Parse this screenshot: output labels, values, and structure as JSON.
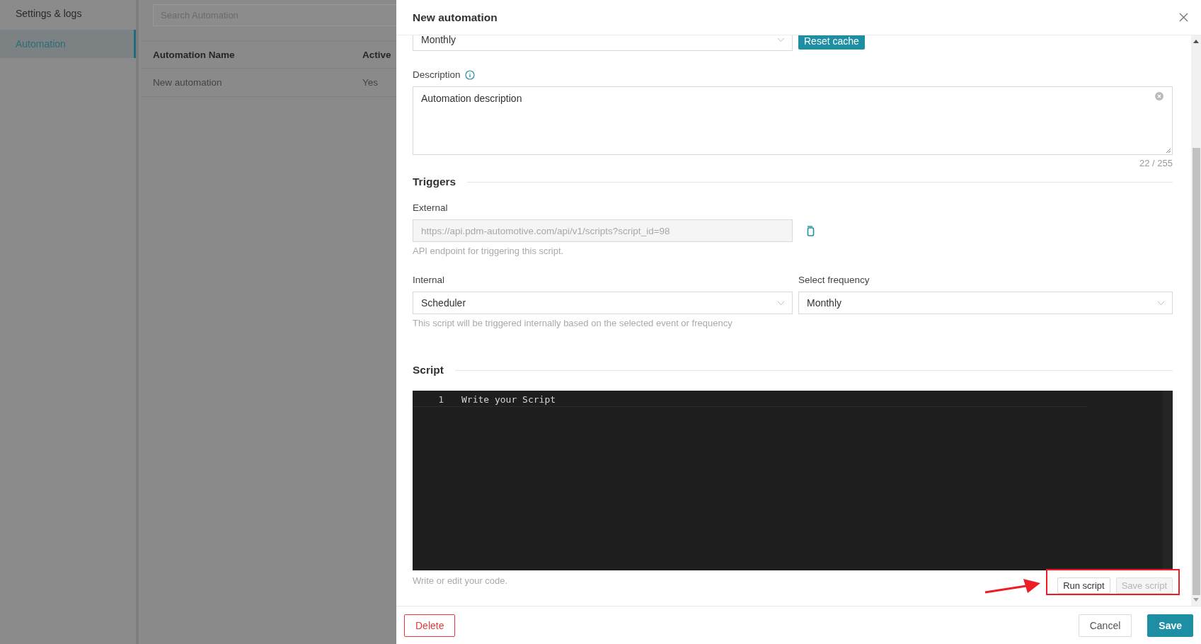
{
  "sidebar": {
    "items": [
      {
        "label": "Settings & logs",
        "selected": false
      },
      {
        "label": "Automation",
        "selected": true
      }
    ]
  },
  "search": {
    "placeholder": "Search Automation"
  },
  "table": {
    "columns": [
      "Automation Name",
      "Active"
    ],
    "rows": [
      [
        "New automation",
        "Yes"
      ]
    ]
  },
  "drawer": {
    "title": "New automation",
    "top_select": {
      "value": "Monthly"
    },
    "reset_button": "Reset cache",
    "description": {
      "label": "Description",
      "value": "Automation description",
      "counter": "22 / 255"
    },
    "triggers": {
      "heading": "Triggers",
      "external": {
        "label": "External",
        "value": "https://api.pdm-automotive.com/api/v1/scripts?script_id=98",
        "help": "API endpoint for triggering this script."
      },
      "internal": {
        "label": "Internal",
        "value": "Scheduler",
        "help": "This script will be triggered internally based on the selected event or frequency"
      },
      "frequency": {
        "label": "Select frequency",
        "value": "Monthly"
      }
    },
    "script": {
      "heading": "Script",
      "lines": [
        {
          "number": "1",
          "code": "Write your Script"
        }
      ],
      "help": "Write or edit your code.",
      "buttons": [
        {
          "label": "Run script",
          "disabled": false
        },
        {
          "label": "Save script",
          "disabled": true
        }
      ]
    },
    "footer": [
      {
        "label": "Delete",
        "kind": "danger"
      },
      {
        "label": "Cancel",
        "kind": "default"
      },
      {
        "label": "Save",
        "kind": "primary"
      }
    ]
  }
}
